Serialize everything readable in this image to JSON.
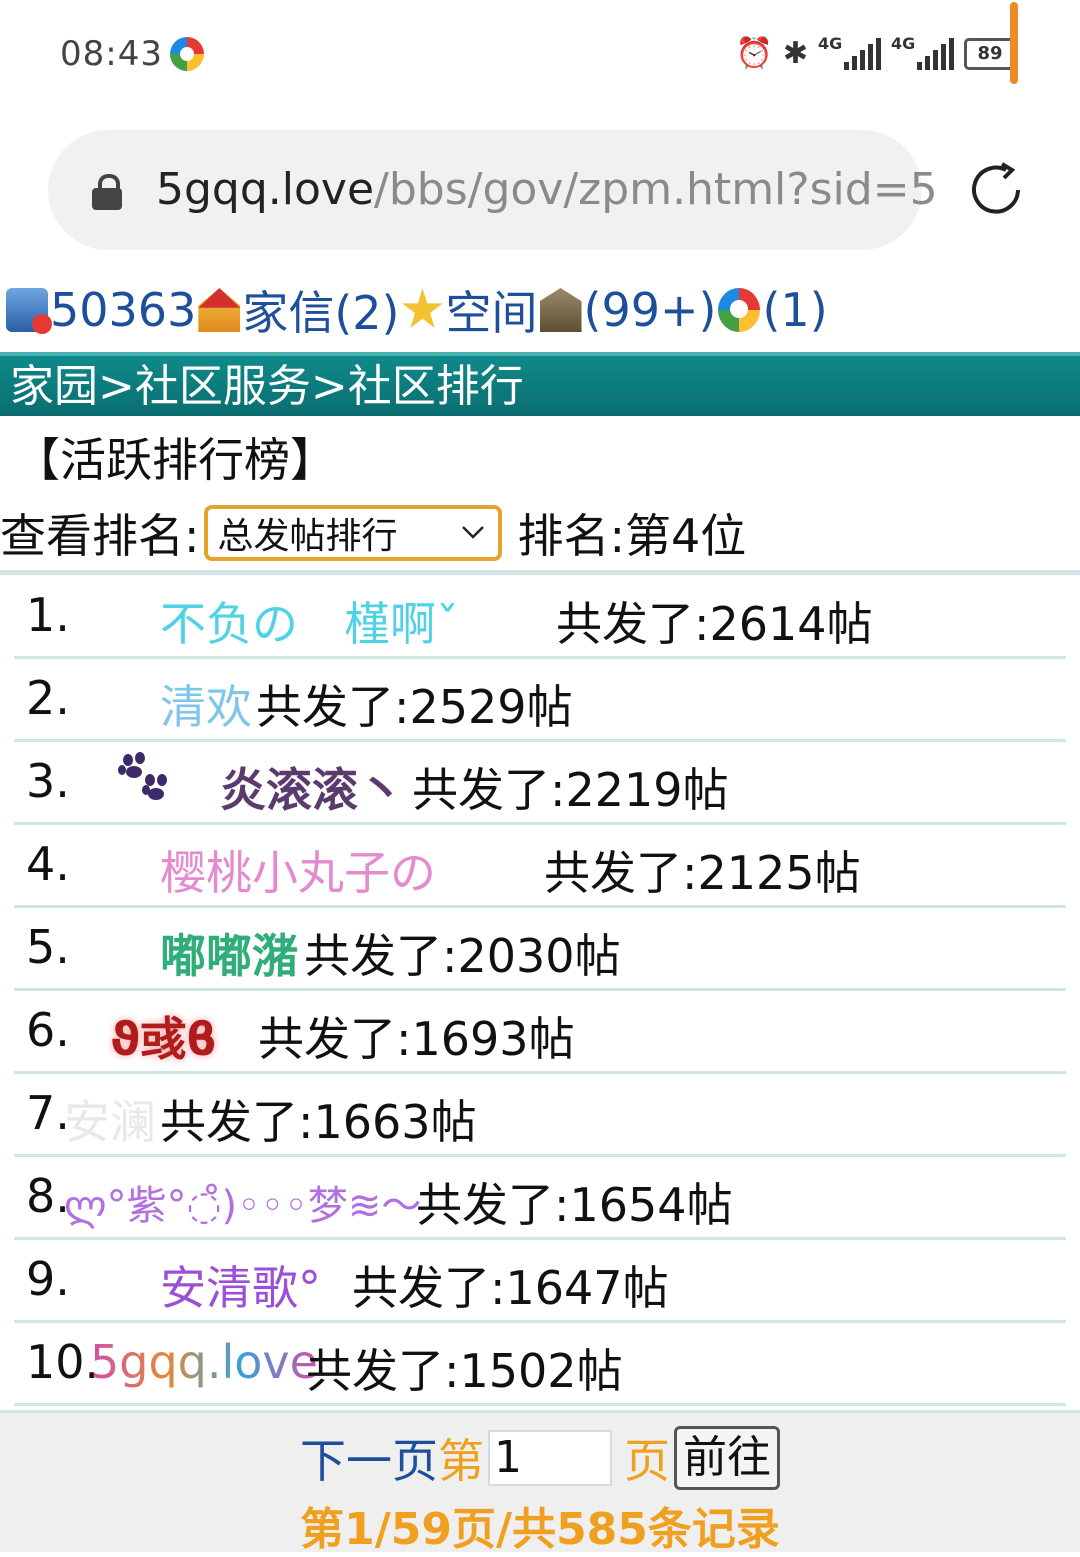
{
  "status_bar": {
    "time": "08:43",
    "network_1": "4G",
    "network_2": "4G",
    "battery": "89",
    "icons": [
      "alarm-icon",
      "bluetooth-icon",
      "signal-icon",
      "signal-icon",
      "battery-icon"
    ]
  },
  "browser": {
    "url_host": "5gqq.love",
    "url_path": "/bbs/gov/zpm.html?sid=5"
  },
  "nav": {
    "user_id": "50363",
    "mail_label": "家信(2)",
    "space_label": "空间",
    "temple_count": "(99+)",
    "ring_count": "(1)"
  },
  "breadcrumb": "家园>社区服务>社区排行",
  "board_title": "【活跃排行榜】",
  "rank": {
    "label": "查看排名:",
    "select_value": "总发帖排行",
    "position": "排名:第4位"
  },
  "rows": [
    {
      "num": "1.",
      "name": "不负の　槿啊ˇ",
      "count": "共发了:2614帖",
      "color": "#4ed3e6"
    },
    {
      "num": "2.",
      "name": "清欢",
      "count": "共发了:2529帖",
      "color": "#7fc6ea"
    },
    {
      "num": "3.",
      "name": "炎滚滚丶",
      "count": "共发了:2219帖",
      "color": "#5b3a6e"
    },
    {
      "num": "4.",
      "name": "樱桃小丸子の",
      "count": "共发了:2125帖",
      "color": "#e58ad0"
    },
    {
      "num": "5.",
      "name": "嘟嘟潴",
      "count": "共发了:2030帖",
      "color": "#2fae7a"
    },
    {
      "num": "6.",
      "name": "ϑ彧ϐ",
      "count": "共发了:1693帖",
      "color": "#b01b1b"
    },
    {
      "num": "7.",
      "name": "安澜",
      "count": "共发了:1663帖",
      "color": "#e8e8e8"
    },
    {
      "num": "8.",
      "name": "ლ°紫°◌̊)◦◦◦梦≋～",
      "count": "共发了:1654帖",
      "color": "#b070e0"
    },
    {
      "num": "9.",
      "name": "安清歌°",
      "count": "共发了:1647帖",
      "color": "#9a4fd6"
    },
    {
      "num": "10.",
      "name": "5gqq.love",
      "count": "共发了:1502帖",
      "color": "#d24fa8"
    }
  ],
  "pager": {
    "next_label": "下一页",
    "page_prefix": "第",
    "page_input_value": "1",
    "page_suffix": "页",
    "go_label": "前往",
    "summary": "第1/59页/共585条记录"
  }
}
